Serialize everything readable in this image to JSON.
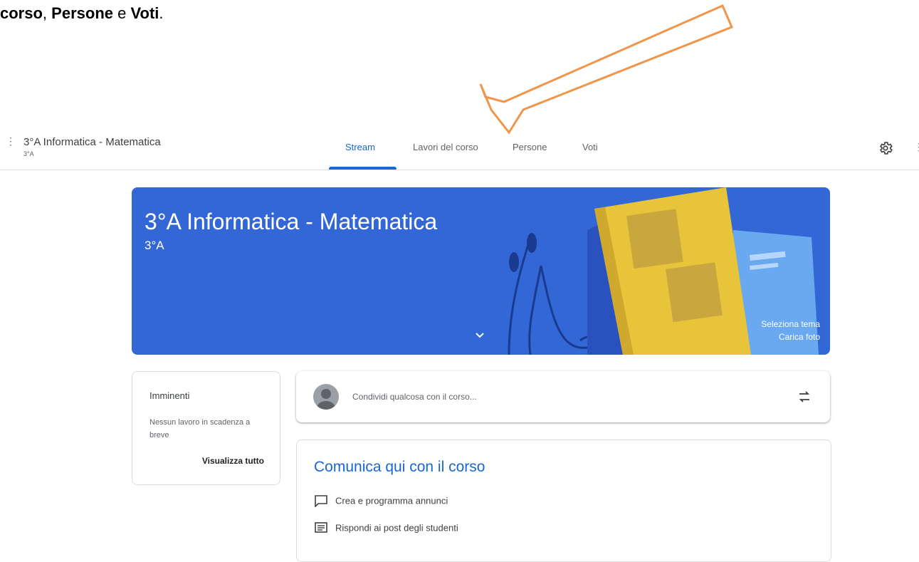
{
  "caption": {
    "word1": "corso",
    "sep1": ",",
    "word2": "Persone",
    "sep2": " e ",
    "word3": "Voti",
    "end": "."
  },
  "header": {
    "class_title": "3°A Informatica - Matematica",
    "class_section": "3°A",
    "tabs": [
      "Stream",
      "Lavori del corso",
      "Persone",
      "Voti"
    ],
    "active_tab": "Stream"
  },
  "banner": {
    "title": "3°A Informatica - Matematica",
    "subtitle": "3°A",
    "select_theme": "Seleziona tema",
    "upload_photo": "Carica foto"
  },
  "upcoming": {
    "title": "Imminenti",
    "text": "Nessun lavoro in scadenza a breve",
    "link": "Visualizza tutto"
  },
  "share": {
    "placeholder": "Condividi qualcosa con il corso..."
  },
  "communicate": {
    "title": "Comunica qui con il corso",
    "items": [
      "Crea e programma annunci",
      "Rispondi ai post degli studenti"
    ]
  },
  "colors": {
    "accent": "#1967d2",
    "banner": "#3367d6",
    "arrow": "#f0954a"
  }
}
